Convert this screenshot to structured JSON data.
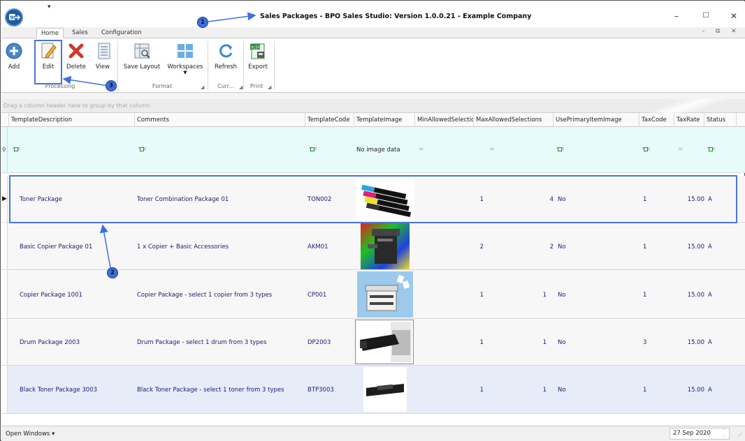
{
  "window": {
    "title": "Sales Packages - BPO Sales Studio: Version 1.0.0.21 - Example Company",
    "qat_glyph": "▾",
    "minimize": "–",
    "maximize": "☐",
    "close": "✕",
    "mdi_min": "–",
    "mdi_restore": "⧉",
    "mdi_close": "✕"
  },
  "ribbon_tabs": [
    "Home",
    "Sales",
    "Configuration"
  ],
  "ribbon": {
    "buttons": {
      "add": "Add",
      "edit": "Edit",
      "delete": "Delete",
      "view": "View",
      "save_layout": "Save Layout",
      "workspaces": "Workspaces",
      "refresh": "Refresh",
      "export": "Export"
    },
    "groups": {
      "processing": "Processing",
      "format": "Format",
      "currency": "Curr...",
      "print": "Print"
    }
  },
  "grid": {
    "group_by_hint": "Drag a column header here to group by that column",
    "columns": [
      "TemplateDescription",
      "Comments",
      "TemplateCode",
      "TemplateImage",
      "MinAllowedSelections",
      "MaxAllowedSelections",
      "UsePrimaryItemImage",
      "TaxCode",
      "TaxRate",
      "Status"
    ],
    "filter_row": {
      "no_image": "No image data",
      "eq": "="
    },
    "rows": [
      {
        "description": "Toner Package",
        "comments": "Toner Combination Package 01",
        "code": "TON002",
        "image": "toner-cartridges",
        "min": "1",
        "max": "4",
        "use_primary": "No",
        "tax_code": "1",
        "tax_rate": "15.00",
        "status": "A"
      },
      {
        "description": "Basic Copier Package 01",
        "comments": "1 x Copier + Basic Accessories",
        "code": "AKM01",
        "image": "copier-colorful",
        "min": "2",
        "max": "2",
        "use_primary": "No",
        "tax_code": "1",
        "tax_rate": "15.00",
        "status": "A"
      },
      {
        "description": "Copier Package 1001",
        "comments": "Copier Package - select 1 copier from 3 types",
        "code": "CP001",
        "image": "copier-blue",
        "min": "1",
        "max": "1",
        "use_primary": "No",
        "tax_code": "1",
        "tax_rate": "15.00",
        "status": "A"
      },
      {
        "description": "Drum Package 2003",
        "comments": "Drum Package - select 1 drum from 3 types",
        "code": "DP2003",
        "image": "drum-unit",
        "min": "1",
        "max": "1",
        "use_primary": "No",
        "tax_code": "3",
        "tax_rate": "15.00",
        "status": "A"
      },
      {
        "description": "Black Toner Package 3003",
        "comments": "Black Toner Package - select 1 toner from 3 types",
        "code": "BTP3003",
        "image": "black-toner",
        "min": "1",
        "max": "1",
        "use_primary": "No",
        "tax_code": "1",
        "tax_rate": "15.00",
        "status": "A"
      }
    ]
  },
  "annotations": [
    "1",
    "2",
    "3"
  ],
  "statusbar": {
    "open_windows": "Open Windows ▾",
    "date": "27 Sep 2020"
  },
  "colors": {
    "accent": "#4a74d8",
    "filter_row": "#e8fbfb",
    "alt_row": "#e6edf9"
  }
}
